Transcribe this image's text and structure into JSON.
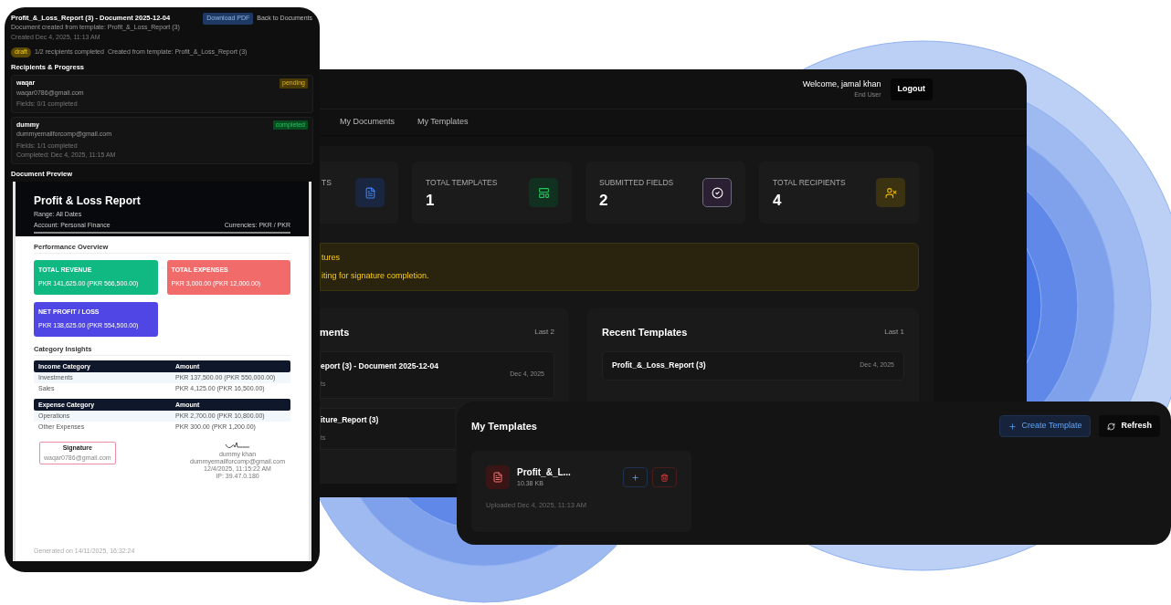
{
  "document_panel": {
    "title": "Profit_&_Loss_Report (3) - Document 2025-12-04",
    "subtitle": "Document created from template: Profit_&_Loss_Report (3)",
    "created": "Created Dec 4, 2025, 11:13 AM",
    "buttons": [
      {
        "label": "Download PDF",
        "kind": "primary"
      },
      {
        "label": "Back to Documents",
        "kind": "ghost"
      }
    ],
    "status_badge": "draft",
    "progress": "1/2 recipients completed",
    "template_note": "Created from template: Profit_&_Loss_Report (3)",
    "recipients_heading": "Recipients & Progress",
    "recipients": [
      {
        "name": "waqar",
        "email": "waqar0786@gmail.com",
        "status": "pending",
        "kind": "pending",
        "lines": [
          "Fields: 0/1 completed"
        ]
      },
      {
        "name": "dummy",
        "email": "dummyemailforcomp@gmail.com",
        "status": "completed",
        "kind": "completed",
        "lines": [
          "Fields: 1/1 completed",
          "Completed: Dec 4, 2025, 11:15 AM"
        ]
      }
    ],
    "preview_heading": "Document Preview",
    "preview": {
      "title": "Profit & Loss Report",
      "range": "Range: All Dates",
      "account": "Account: Personal Finance",
      "currencies": "Currencies: PKR / PKR",
      "performance_heading": "Performance Overview",
      "metrics": [
        {
          "label": "TOTAL REVENUE",
          "value": "PKR 141,625.00 (PKR 566,500.00)",
          "kind": "revenue"
        },
        {
          "label": "TOTAL EXPENSES",
          "value": "PKR 3,000.00 (PKR 12,000.00)",
          "kind": "expense"
        },
        {
          "label": "NET PROFIT / LOSS",
          "value": "PKR 138,625.00 (PKR 554,500.00)",
          "kind": "net"
        }
      ],
      "insights_heading": "Category Insights",
      "tables": [
        {
          "columns": [
            "Income Category",
            "Amount"
          ],
          "rows": [
            [
              "Investments",
              "PKR 137,500.00 (PKR 550,000.00)"
            ],
            [
              "Sales",
              "PKR 4,125.00 (PKR 16,500.00)"
            ]
          ]
        },
        {
          "columns": [
            "Expense Category",
            "Amount"
          ],
          "rows": [
            [
              "Operations",
              "PKR 2,700.00 (PKR 10,800.00)"
            ],
            [
              "Other Expenses",
              "PKR 300.00 (PKR 1,200.00)"
            ]
          ]
        }
      ],
      "signatures": [
        {
          "kind": "pending",
          "label": "Signature",
          "lines": [
            "waqar0786@gmail.com"
          ]
        },
        {
          "kind": "signed",
          "lines": [
            "dummy khan",
            "dummyemailforcomp@gmail.com",
            "12/4/2025, 11:15:22 AM",
            "IP: 39.47.0.180"
          ]
        }
      ],
      "generated": "Generated on 14/11/2025, 16:32:24"
    }
  },
  "dashboard": {
    "welcome": "Welcome, jamal khan",
    "role": "End User",
    "logout": "Logout",
    "tabs": [
      {
        "label": "My Documents",
        "selected": false
      },
      {
        "label": "My Templates",
        "selected": false
      }
    ],
    "stats": [
      {
        "label": "TS",
        "kind": "documents"
      },
      {
        "label": "TOTAL TEMPLATES",
        "value": "1",
        "kind": "templates"
      },
      {
        "label": "SUBMITTED FIELDS",
        "value": "2",
        "kind": "fields"
      },
      {
        "label": "TOTAL RECIPIENTS",
        "value": "4",
        "kind": "recipients"
      }
    ],
    "alert": {
      "title": "tures",
      "message": "iting for signature completion."
    },
    "recent_documents": {
      "title": "ments",
      "count": "Last 2",
      "items": [
        {
          "title": "eport (3) - Document 2025-12-04",
          "subtitle": "ts",
          "date": "Dec 4, 2025"
        },
        {
          "title": "iture_Report (3)",
          "subtitle": "ts"
        }
      ]
    },
    "recent_templates": {
      "title": "Recent Templates",
      "count": "Last 1",
      "items": [
        {
          "title": "Profit_&_Loss_Report (3)",
          "date": "Dec 4, 2025"
        }
      ]
    }
  },
  "templates_window": {
    "title": "My Templates",
    "buttons": [
      {
        "label": "Create Template",
        "kind": "create"
      },
      {
        "label": "Refresh",
        "kind": "refresh"
      }
    ],
    "cards": [
      {
        "name": "Profit_&_L...",
        "size": "10.38 KB",
        "uploaded": "Uploaded Dec 4, 2025, 11:13 AM"
      }
    ]
  }
}
